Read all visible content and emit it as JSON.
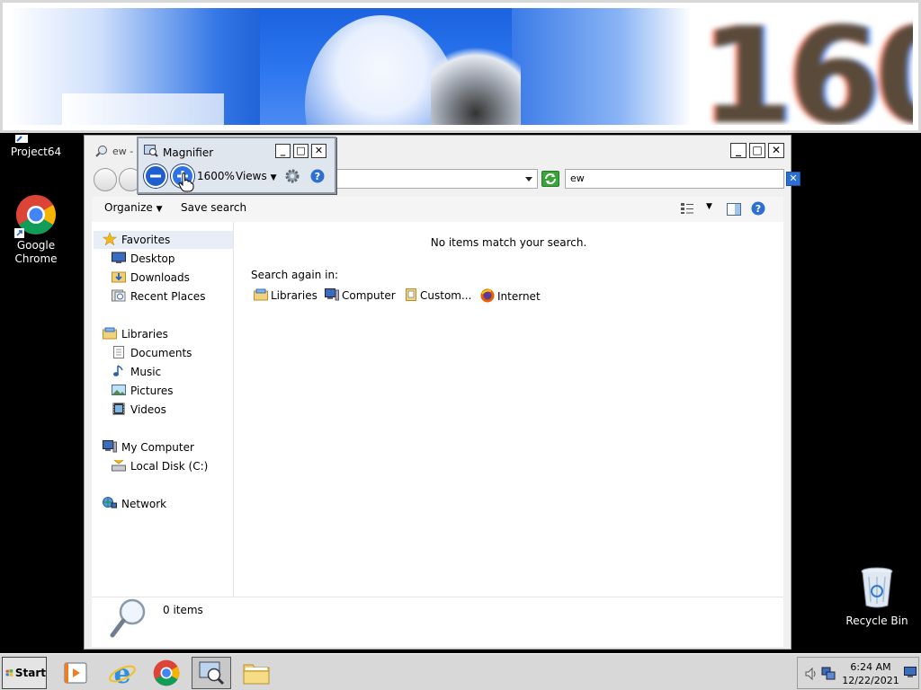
{
  "colors": {
    "desktop_bg": "#000000",
    "window_bg": "#f0f0f0",
    "accent_blue": "#1d5fd6"
  },
  "desktop": {
    "icons": [
      {
        "label": "Project64",
        "icon": "project64-icon"
      },
      {
        "label": "Google Chrome",
        "label_line1": "Google",
        "label_line2": "Chrome",
        "icon": "chrome-icon"
      },
      {
        "label": "Recycle Bin",
        "icon": "recycle-bin-icon"
      }
    ]
  },
  "lens": {
    "zoom_text": "160"
  },
  "explorer": {
    "title_fragment": "ew -",
    "search_value": "ew",
    "toolbar": {
      "organize": "Organize",
      "save_search": "Save search"
    },
    "nav": {
      "favorites": "Favorites",
      "favorites_items": [
        "Desktop",
        "Downloads",
        "Recent Places"
      ],
      "libraries": "Libraries",
      "libraries_items": [
        "Documents",
        "Music",
        "Pictures",
        "Videos"
      ],
      "computer": "My Computer",
      "computer_items": [
        "Local Disk (C:)"
      ],
      "network": "Network"
    },
    "content": {
      "no_items": "No items match your search.",
      "search_again": "Search again in:",
      "locations": [
        "Libraries",
        "Computer",
        "Custom...",
        "Internet"
      ]
    },
    "status": {
      "count": "0 items"
    }
  },
  "magnifier": {
    "title": "Magnifier",
    "zoom": "1600%",
    "views": "Views"
  },
  "taskbar": {
    "start": "Start",
    "time": "6:24 AM",
    "date": "12/22/2021"
  }
}
